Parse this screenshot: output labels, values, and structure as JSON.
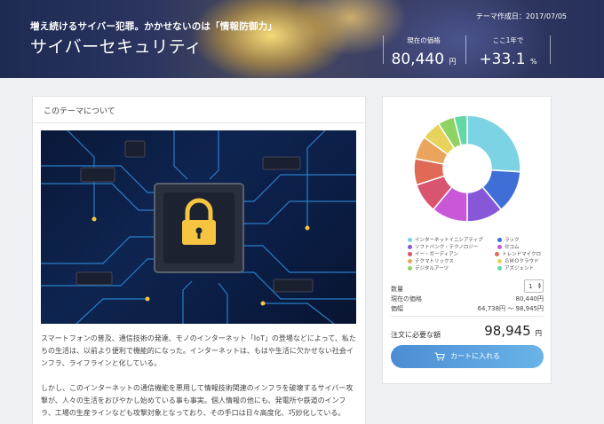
{
  "hero": {
    "tagline": "増え続けるサイバー犯罪。かかせないのは「情報防御力」",
    "title": "サイバーセキュリティ",
    "created": "テーマ作成日：2017/07/05",
    "price_label": "現在の価格",
    "price_value": "80,440",
    "price_unit": "円",
    "change_label": "ここ1年で",
    "change_value": "+33.1",
    "change_unit": "%"
  },
  "about": {
    "heading": "このテーマについて",
    "paragraph1": "スマートフォンの普及、通信技術の発達、モノのインターネット「IoT」の登場などによって、私たちの生活は、以前より便利で機能的になった。インターネットは、もはや生活に欠かせない社会インフラ、ライフラインと化している。",
    "paragraph2": "しかし、このインターネットの通信機能を悪用して情報技術関連のインフラを破壊するサイバー攻撃が、人々の生活をおびやかし始めている事も事実。個人情報の他にも、発電所や鉄道のインフラ、工場の生産ラインなども攻撃対象となっており、その手口は日々高度化、巧妙化している。"
  },
  "chart_data": {
    "type": "pie",
    "categories": [
      "インターネットイニシアティブ",
      "ラック",
      "ソフトバンク・テクノロジー",
      "セコム",
      "イー・ガーディアン",
      "トレンドマイクロ",
      "テクマトリックス",
      "ＧＭＯクラウド",
      "デジタルアーツ",
      "アズジェント"
    ],
    "values": [
      26,
      13,
      11,
      11,
      9,
      8,
      7,
      6,
      5,
      4
    ],
    "colors": [
      "#7bd3e3",
      "#3f6fd6",
      "#8757d8",
      "#c958d8",
      "#d9546f",
      "#e06a55",
      "#e9a55b",
      "#e7d35b",
      "#8fd365",
      "#63d7a5"
    ]
  },
  "order": {
    "quantity_label": "数量",
    "quantity_value": "1",
    "price_label": "現在の価格",
    "price_value": "80,440円",
    "range_label": "価幅",
    "range_value": "64,738円 〜 98,945円",
    "total_label": "注文に必要な額",
    "total_value": "98,945",
    "total_unit": "円",
    "cart_label": "カートに入れる"
  },
  "icons": {
    "cart": "cart-icon",
    "lock": "padlock-icon"
  }
}
